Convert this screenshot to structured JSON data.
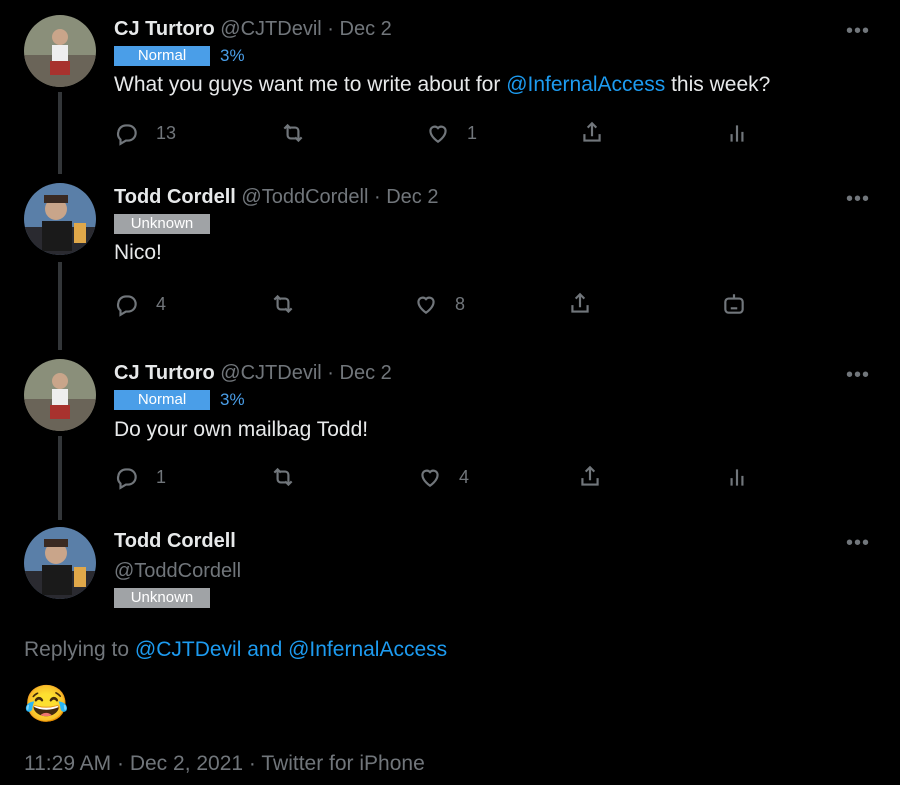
{
  "tweets": [
    {
      "name": "CJ Turtoro",
      "handle": "@CJTDevil",
      "sep": "·",
      "date": "Dec 2",
      "badge": "Normal",
      "percent": "3%",
      "text_before": "What you guys want me to write about for ",
      "mention": "@InfernalAccess",
      "text_after": " this week?",
      "replies": "13",
      "likes": "1"
    },
    {
      "name": "Todd Cordell",
      "handle": "@ToddCordell",
      "sep": "·",
      "date": "Dec 2",
      "badge": "Unknown",
      "text": "Nico!",
      "replies": "4",
      "likes": "8"
    },
    {
      "name": "CJ Turtoro",
      "handle": "@CJTDevil",
      "sep": "·",
      "date": "Dec 2",
      "badge": "Normal",
      "percent": "3%",
      "text": "Do your own mailbag Todd!",
      "replies": "1",
      "likes": "4"
    }
  ],
  "main": {
    "name": "Todd Cordell",
    "handle": "@ToddCordell",
    "badge": "Unknown",
    "replying_label": "Replying to",
    "reply_mentions": "@CJTDevil and @InfernalAccess",
    "emoji": "😂",
    "timestamp": "11:29 AM · Dec 2, 2021 · Twitter for iPhone"
  },
  "more_symbol": "•••",
  "colors": {
    "background": "#000000",
    "text": "#e7e9ea",
    "muted": "#71767b",
    "link": "#1d9bf0",
    "normal_badge": "#4a9ee8",
    "unknown_badge": "#a0a3a6"
  }
}
